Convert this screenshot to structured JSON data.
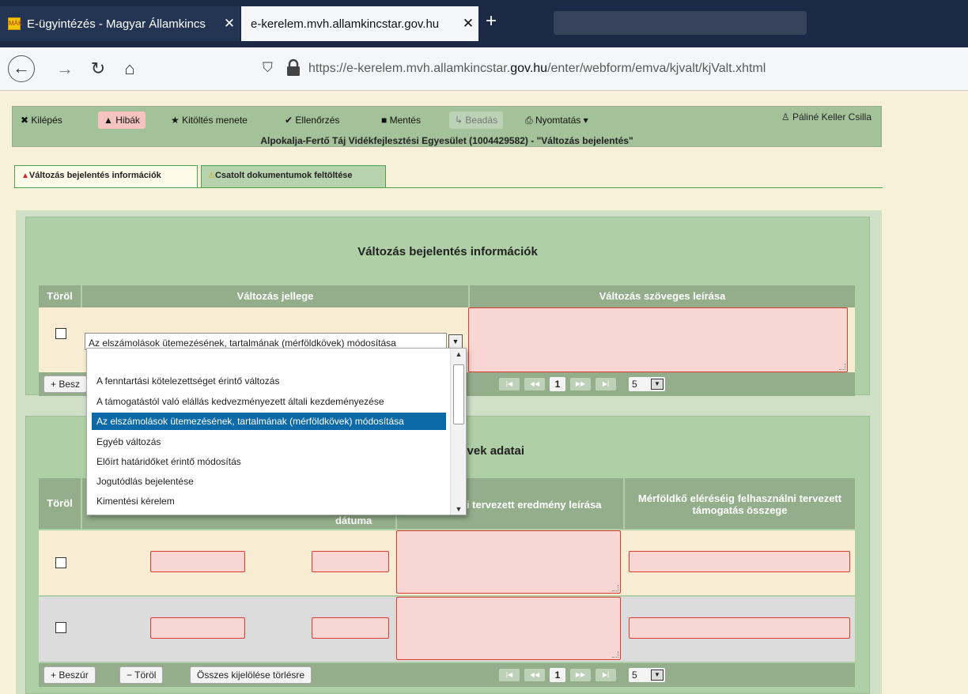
{
  "browser": {
    "tabs": [
      {
        "title": "E-ügyintézés - Magyar Államkincs",
        "close": "✕",
        "favicon": "MÁK"
      },
      {
        "title": "e-kerelem.mvh.allamkincstar.gov.hu",
        "close": "✕"
      }
    ],
    "new_tab": "+",
    "url_prefix": "https://e-kerelem.mvh.allamkincstar.",
    "url_domain": "gov.hu",
    "url_path": "/enter/webform/emva/kjvalt/kjValt.xhtml",
    "icons": [
      "back-icon",
      "forward-icon",
      "reload-icon",
      "home-icon",
      "shield-icon",
      "lock-icon"
    ]
  },
  "toolbar": {
    "kilepes": "Kilépés",
    "hibak": "Hibák",
    "kitoltes": "Kitöltés menete",
    "ellenorzes": "Ellenőrzés",
    "mentes": "Mentés",
    "beadas": "Beadás",
    "nyomtatas": "Nyomtatás",
    "user": "Páliné Keller Csilla",
    "title": "Alpokalja-Fertő Táj Vidékfejlesztési Egyesület (1004429582) - \"Változás bejelentés\""
  },
  "form_tabs": {
    "tab1": "Változás bejelentés információk",
    "tab2": "Csatolt dokumentumok feltöltése"
  },
  "panel1": {
    "title": "Változás bejelentés információk",
    "col_torol": "Töröl",
    "col_jellege": "Változás jellege",
    "col_leiras": "Változás szöveges leírása",
    "selected_value": "Az elszámolások ütemezésének, tartalmának (mérföldkövek) módosítása",
    "insert_btn": "+ Besz",
    "page": "1",
    "page_size": "5"
  },
  "dropdown": {
    "options": [
      "A fenntartási kötelezettséget érintő változás",
      "A támogatástól való elállás kedvezményezett általi kezdeményezése",
      "Az elszámolások ütemezésének, tartalmának (mérföldkövek) módosítása",
      "Egyéb változás",
      "Előírt határidőket érintő módosítás",
      "Jogutódlás bejelentése",
      "Kimentési kérelem"
    ],
    "selected_index": 2
  },
  "panel2": {
    "title_visible": "kövek adatai",
    "col_torol": "Töröl",
    "col_datuma": "dátuma",
    "col_eredmeny": "ni tervezett eredmény leírása",
    "col_osszeg": "Mérföldkő eléréséig felhasználni tervezett támogatás összege",
    "btn_beszur": "+ Beszúr",
    "btn_torol": "− Töröl",
    "btn_osszes": "Összes kijelölése törlésre",
    "page": "1",
    "page_size": "5"
  },
  "colors": {
    "toolbar_bg": "#a4c29a",
    "panel_bg": "#afcfa6",
    "header_bg": "#94ae8b",
    "error_border": "#e23b2f",
    "error_fill": "#f7d6d3",
    "selected_option": "#0d6aa8"
  }
}
